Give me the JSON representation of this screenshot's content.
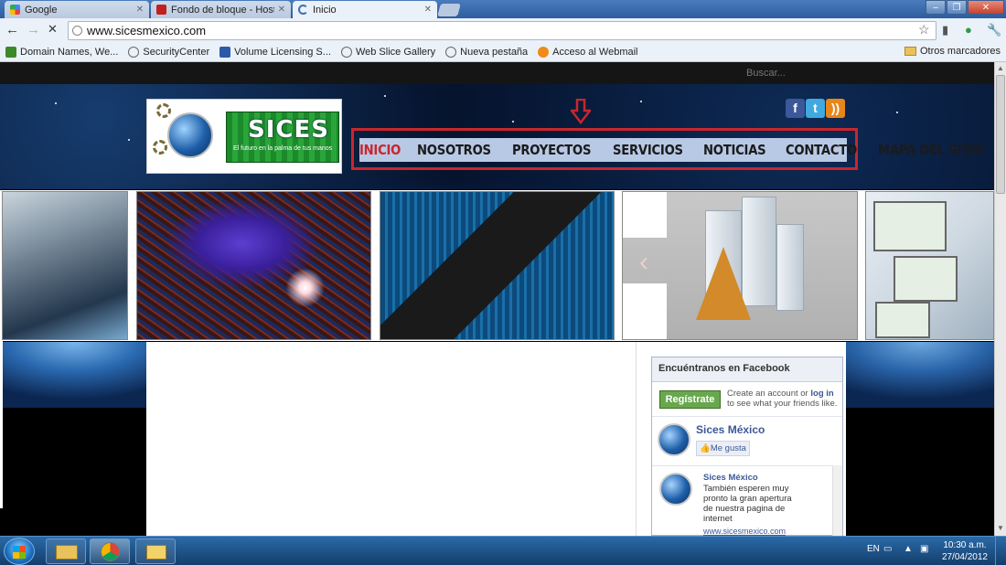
{
  "browser": {
    "tabs": [
      {
        "label": "Google",
        "icon": "google-favicon",
        "active": false
      },
      {
        "label": "Fondo de bloque - Hosting",
        "icon": "hosting-favicon",
        "active": false
      },
      {
        "label": "Inicio",
        "icon": "loading-icon",
        "active": true
      }
    ],
    "url": "www.sicesmexico.com",
    "bookmarks": [
      {
        "label": "Domain Names, We...",
        "icon": "nsi-icon"
      },
      {
        "label": "SecurityCenter",
        "icon": "globe-icon"
      },
      {
        "label": "Volume Licensing S...",
        "icon": "ms-icon"
      },
      {
        "label": "Web Slice Gallery",
        "icon": "globe-icon"
      },
      {
        "label": "Nueva pestaña",
        "icon": "globe-icon"
      },
      {
        "label": "Acceso al Webmail",
        "icon": "cpanel-icon"
      }
    ],
    "other_bookmarks": "Otros marcadores"
  },
  "site": {
    "search_placeholder": "Buscar...",
    "logo_text": "SICES",
    "logo_tagline": "El futuro en la palma de tus manos",
    "menu": [
      {
        "label": "INICIO",
        "active": true
      },
      {
        "label": "NOSOTROS",
        "active": false
      },
      {
        "label": "PROYECTOS",
        "active": false
      },
      {
        "label": "SERVICIOS",
        "active": false
      },
      {
        "label": "NOTICIAS",
        "active": false
      },
      {
        "label": "CONTACTO",
        "active": false
      },
      {
        "label": "MAPA DEL SITIO",
        "active": false
      }
    ],
    "social": [
      "facebook-icon",
      "twitter-icon",
      "rss-icon"
    ],
    "colors": {
      "menu_active": "#c9262c",
      "menu_bg": "#b8c9e6",
      "highlight_frame": "#c9262c"
    }
  },
  "facebook": {
    "title": "Encuéntranos en Facebook",
    "register": "Regístrate",
    "create_account_pre": "Create an account or",
    "log_in": "log in",
    "create_account_post": "to see what your friends like.",
    "page_name": "Sices México",
    "like": "Me gusta",
    "post_author": "Sices México",
    "post_text": "También esperen muy pronto la gran apertura de nuestra pagina de internet",
    "post_link": "www.sicesmexico.com"
  },
  "taskbar": {
    "language": "EN",
    "time": "10:30 a.m.",
    "date": "27/04/2012"
  }
}
